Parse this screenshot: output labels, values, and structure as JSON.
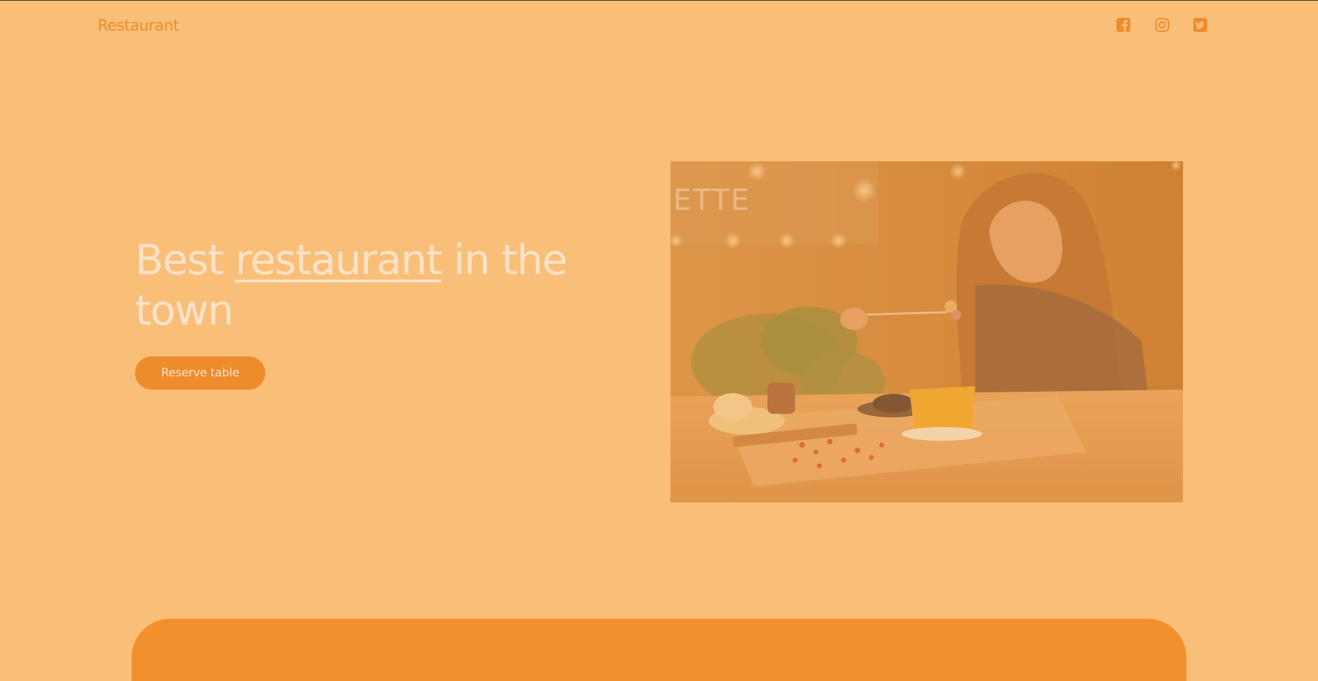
{
  "header": {
    "brand": "Restaurant",
    "socials": [
      {
        "name": "facebook",
        "icon": "facebook-icon"
      },
      {
        "name": "instagram",
        "icon": "instagram-icon"
      },
      {
        "name": "twitter",
        "icon": "twitter-icon"
      }
    ]
  },
  "hero": {
    "title_before": "Best ",
    "title_highlight": "restaurant",
    "title_after": " in the town",
    "cta_label": "Reserve table",
    "image_alt": "Woman enjoying a meal in a warmly lit restaurant"
  },
  "colors": {
    "background": "#f9bf79",
    "accent": "#ee8b2a",
    "title_text": "#fde2c7",
    "panel": "#f2902e"
  }
}
